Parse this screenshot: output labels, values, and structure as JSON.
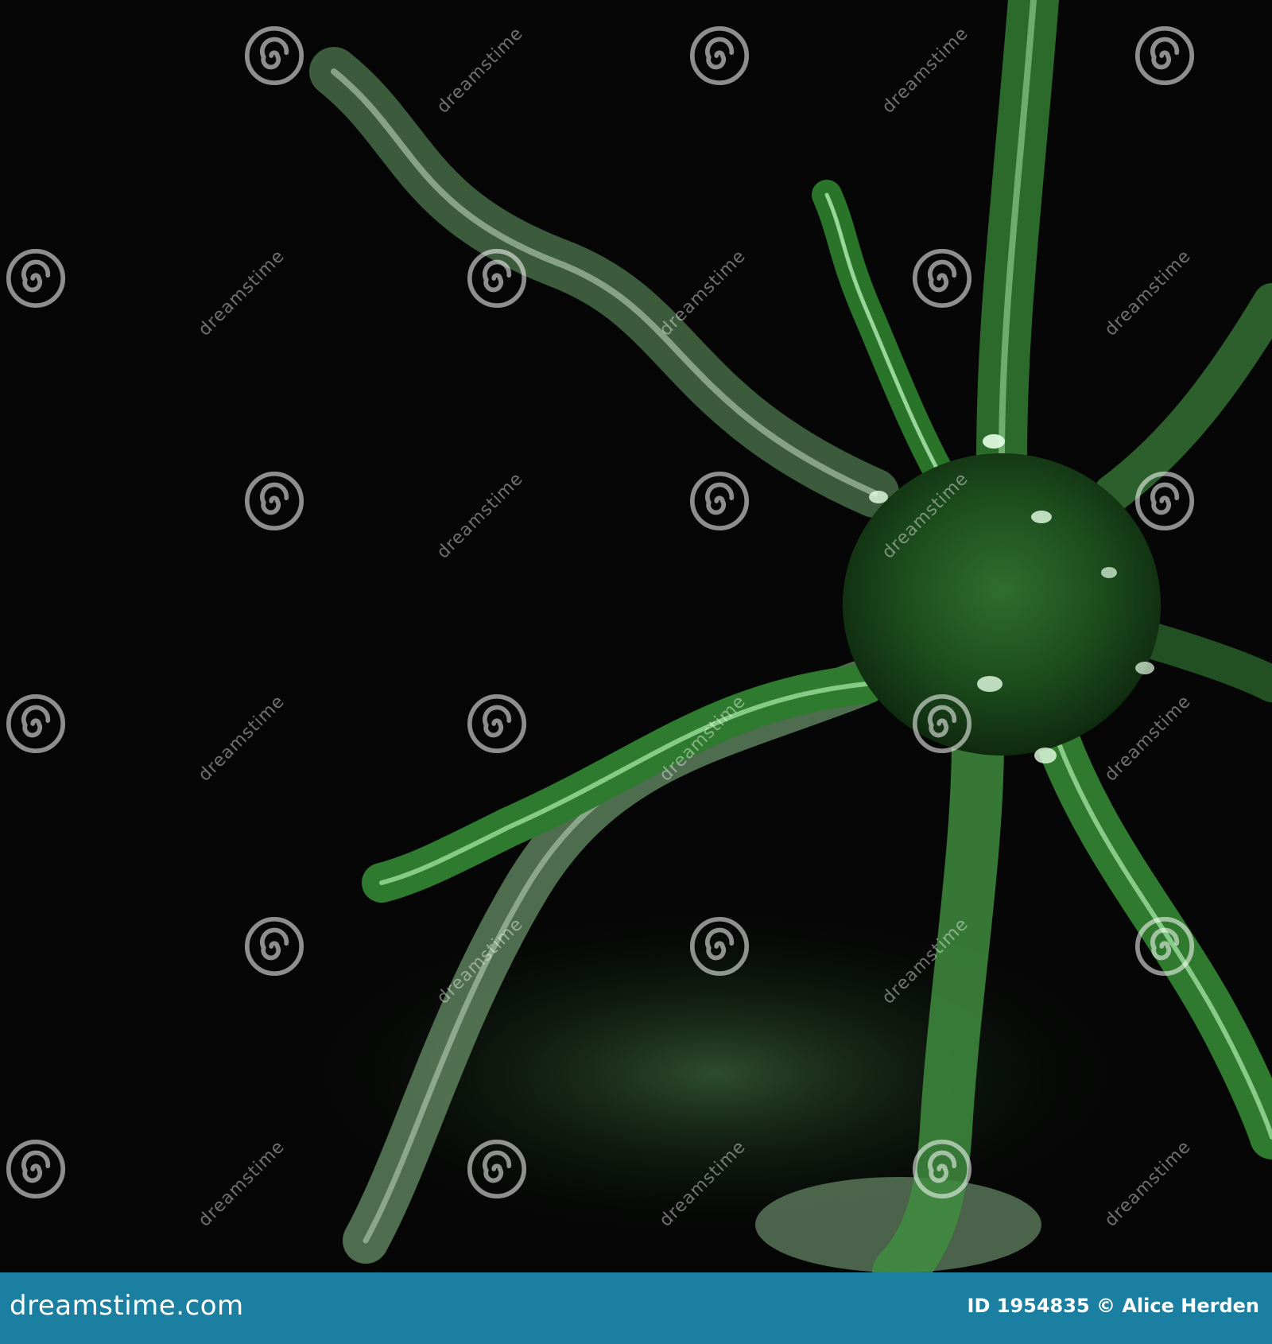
{
  "image": {
    "subject": "green-glass-neuron-cell",
    "colors": {
      "background": "#060606",
      "cell_dark": "#1a4a1a",
      "cell_light": "#6fbf6f",
      "highlight": "#d8ffd8",
      "footer_bar": "#1a7fa0"
    }
  },
  "watermark": {
    "text": "dreamstime",
    "icon": "spiral-logo-icon"
  },
  "footer": {
    "site": "dreamstime.com",
    "credit": "ID 1954835 © Alice Herden"
  }
}
